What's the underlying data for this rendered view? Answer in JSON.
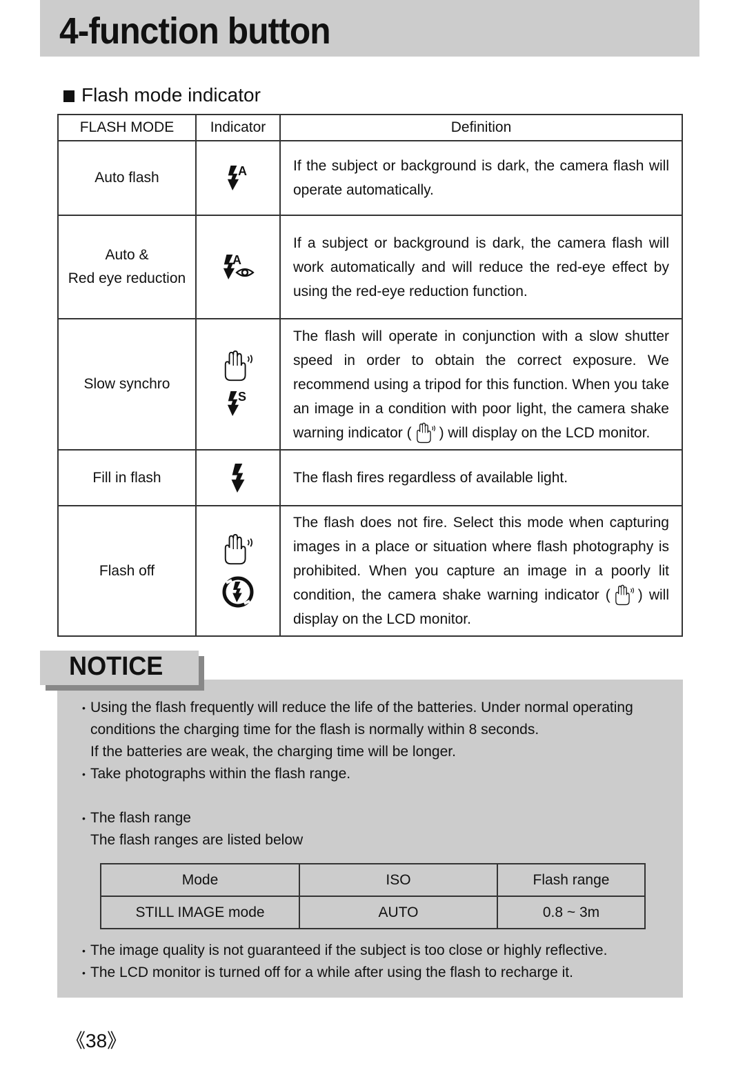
{
  "page": {
    "title": "4-function button",
    "section_heading": "Flash mode indicator",
    "page_number": "《38》"
  },
  "flash_table": {
    "headers": [
      "FLASH MODE",
      "Indicator",
      "Definition"
    ],
    "rows": [
      {
        "mode": [
          "Auto flash"
        ],
        "icons": [
          "flash-auto-icon"
        ],
        "definition": "If the subject or background is dark, the camera flash will operate automatically."
      },
      {
        "mode": [
          "Auto &",
          "Red eye reduction"
        ],
        "icons": [
          "flash-auto-red-eye-icon"
        ],
        "definition": "If a subject or background is dark, the camera flash will work automatically and will reduce the red-eye effect by using the red-eye reduction function."
      },
      {
        "mode": [
          "Slow synchro"
        ],
        "icons": [
          "camera-shake-hand-icon",
          "flash-slow-sync-icon"
        ],
        "definition_before": "The flash will operate in conjunction with a slow shutter speed in order to obtain the correct exposure. We recommend using a tripod for this function. When you take an image in a condition with poor light, the camera shake warning indicator (",
        "definition_after": ") will display on the LCD monitor."
      },
      {
        "mode": [
          "Fill in flash"
        ],
        "icons": [
          "flash-fill-icon"
        ],
        "definition": "The flash fires regardless of available light."
      },
      {
        "mode": [
          "Flash off"
        ],
        "icons": [
          "camera-shake-hand-icon",
          "flash-off-icon"
        ],
        "definition_before": "The flash does not fire. Select this mode when capturing images in a place or situation where flash photography is prohibited. When you capture an image in a poorly lit condition, the camera shake warning indicator (",
        "definition_after": ") will display on the LCD monitor."
      }
    ]
  },
  "notice": {
    "label": "NOTICE",
    "items": [
      {
        "lines": [
          "Using the flash frequently will reduce the life of the batteries. Under normal operating",
          "conditions the charging time for the flash is normally within 8 seconds.",
          "If the batteries are weak, the charging time will be longer."
        ]
      },
      {
        "lines": [
          "Take photographs within the flash range."
        ]
      },
      {
        "lines": [
          "The flash range",
          "The flash ranges are listed below"
        ]
      }
    ],
    "range_table": {
      "headers": [
        "Mode",
        "ISO",
        "Flash range"
      ],
      "rows": [
        [
          "STILL IMAGE mode",
          "AUTO",
          "0.8 ~ 3m"
        ]
      ]
    },
    "bottom_items": [
      "The image quality is not guaranteed if the subject is too close or highly reflective.",
      "The LCD monitor is turned off for a while after using the flash to recharge it."
    ],
    "bullet": "•"
  }
}
